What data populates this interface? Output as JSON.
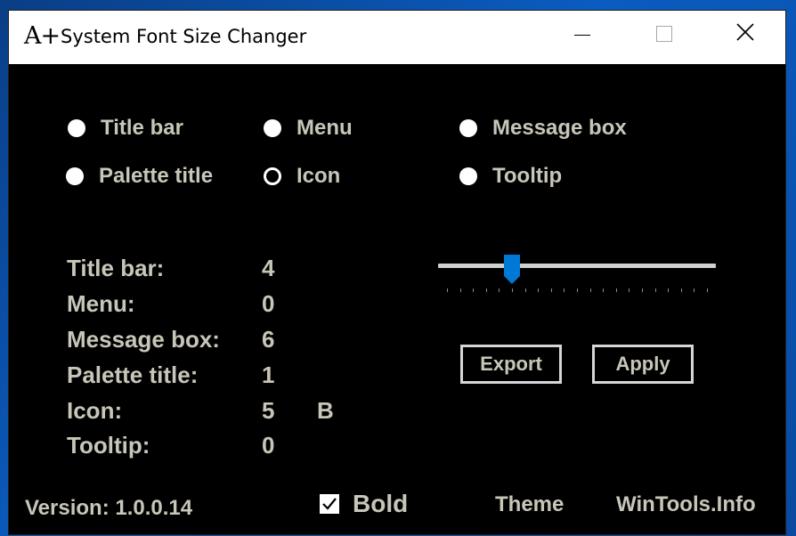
{
  "window": {
    "title": "System Font Size Changer",
    "app_icon_text": "A+"
  },
  "radios": [
    {
      "label": "Title bar",
      "selected": false
    },
    {
      "label": "Menu",
      "selected": false
    },
    {
      "label": "Message box",
      "selected": false
    },
    {
      "label": "Palette title",
      "selected": false
    },
    {
      "label": "Icon",
      "selected": true
    },
    {
      "label": "Tooltip",
      "selected": false
    }
  ],
  "stats": [
    {
      "label": "Title bar:",
      "value": "4"
    },
    {
      "label": "Menu:",
      "value": "0"
    },
    {
      "label": "Message box:",
      "value": "6"
    },
    {
      "label": "Palette title:",
      "value": "1"
    },
    {
      "label": "Icon:",
      "value": "5",
      "flag": "B"
    },
    {
      "label": "Tooltip:",
      "value": "0"
    }
  ],
  "slider": {
    "value": 5,
    "min": 0,
    "max": 20
  },
  "buttons": {
    "export": "Export",
    "apply": "Apply"
  },
  "footer": {
    "version": "Version: 1.0.0.14",
    "bold_label": "Bold",
    "bold_checked": true,
    "theme": "Theme",
    "site": "WinTools.Info"
  },
  "colors": {
    "window_bg": "#000000",
    "label": "#c8c6b8",
    "accent": "#0078d7"
  }
}
